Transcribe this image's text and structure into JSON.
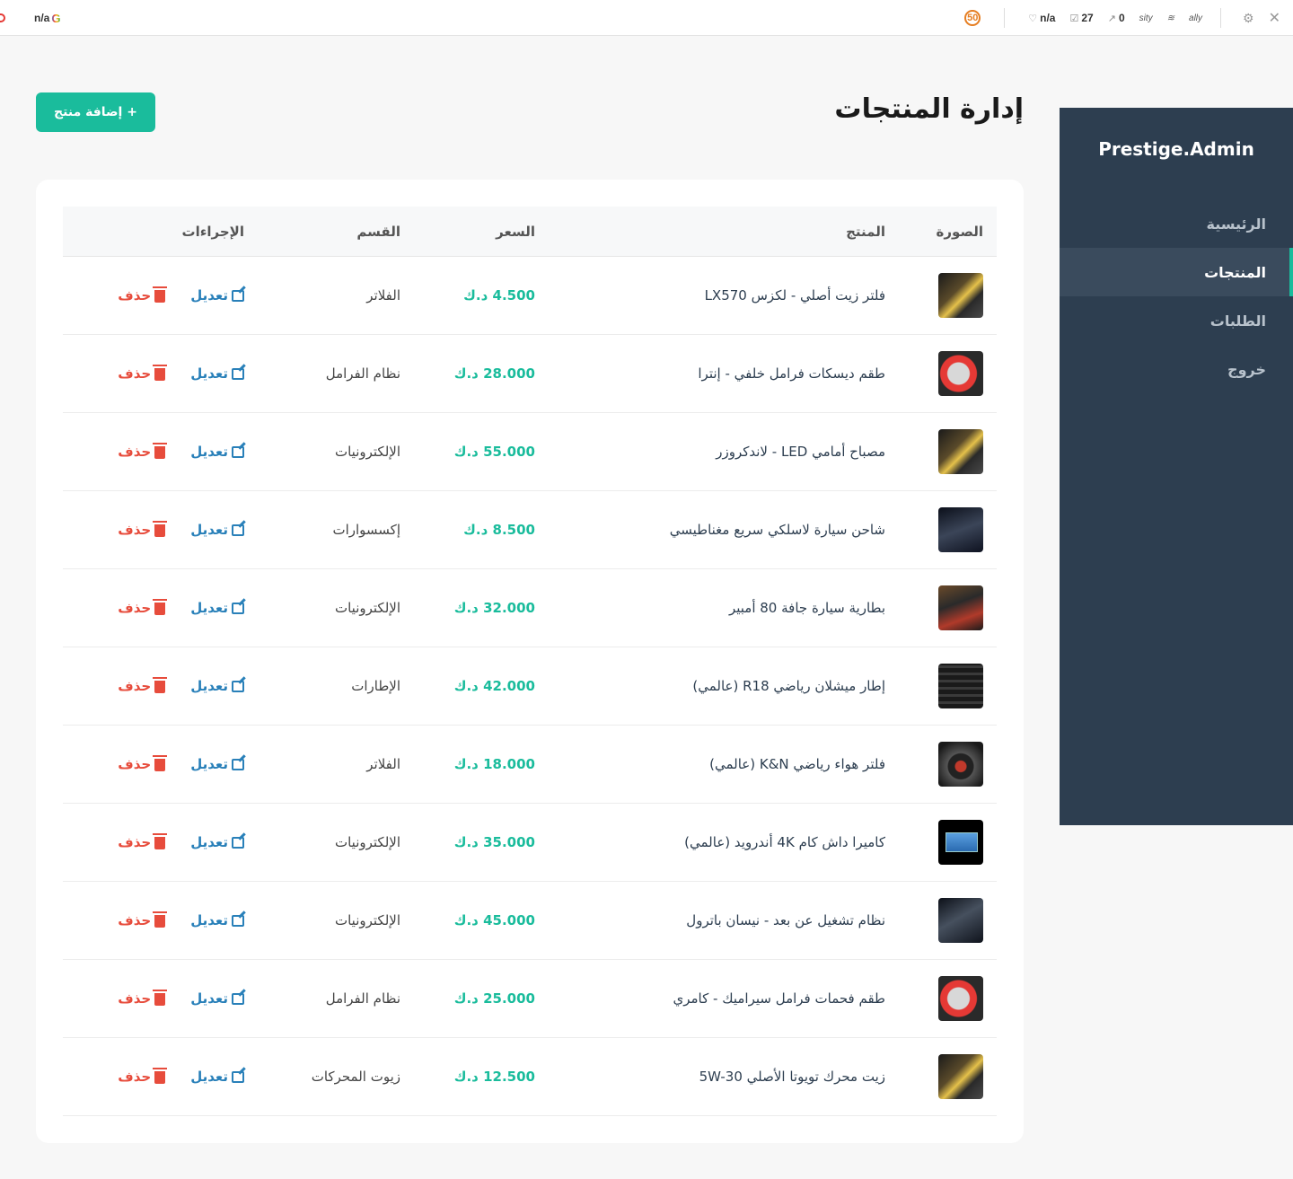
{
  "toolbar": {
    "left_text": "n/a",
    "google_icon": "G",
    "seo_badge": "50",
    "rank": "n/a",
    "pages": "27",
    "links": "0",
    "icon_a": "sity",
    "icon_b": "≋",
    "icon_c": "ally"
  },
  "sidebar": {
    "brand": "Prestige.Admin",
    "items": [
      {
        "label": "الرئيسية",
        "active": false
      },
      {
        "label": "المنتجات",
        "active": true
      },
      {
        "label": "الطلبات",
        "active": false
      },
      {
        "label": "خروج",
        "active": false
      }
    ]
  },
  "header": {
    "title": "إدارة المنتجات",
    "add_button": "+ إضافة منتج"
  },
  "table": {
    "columns": {
      "image": "الصورة",
      "product": "المنتج",
      "price": "السعر",
      "category": "القسم",
      "actions": "الإجراءات"
    },
    "edit_label": "تعديل",
    "delete_label": "حذف",
    "rows": [
      {
        "thumb": "oil",
        "name": "فلتر زيت أصلي - لكزس LX570",
        "price": "4.500 د.ك",
        "category": "الفلاتر"
      },
      {
        "thumb": "brake",
        "name": "طقم ديسكات فرامل خلفي - إنترا",
        "price": "28.000 د.ك",
        "category": "نظام الفرامل"
      },
      {
        "thumb": "oil",
        "name": "مصباح أمامي LED - لاندكروزر",
        "price": "55.000 د.ك",
        "category": "الإلكترونيات"
      },
      {
        "thumb": "charger",
        "name": "شاحن سيارة لاسلكي سريع مغناطيسي",
        "price": "8.500 د.ك",
        "category": "إكسسوارات"
      },
      {
        "thumb": "battery",
        "name": "بطارية سيارة جافة 80 أمبير",
        "price": "32.000 د.ك",
        "category": "الإلكترونيات"
      },
      {
        "thumb": "tire",
        "name": "إطار ميشلان رياضي R18 (عالمي)",
        "price": "42.000 د.ك",
        "category": "الإطارات"
      },
      {
        "thumb": "filter",
        "name": "فلتر هواء رياضي K&N (عالمي)",
        "price": "18.000 د.ك",
        "category": "الفلاتر"
      },
      {
        "thumb": "dash",
        "name": "كاميرا داش كام 4K أندرويد (عالمي)",
        "price": "35.000 د.ك",
        "category": "الإلكترونيات"
      },
      {
        "thumb": "remote",
        "name": "نظام تشغيل عن بعد - نيسان باترول",
        "price": "45.000 د.ك",
        "category": "الإلكترونيات"
      },
      {
        "thumb": "brake",
        "name": "طقم فحمات فرامل سيراميك - كامري",
        "price": "25.000 د.ك",
        "category": "نظام الفرامل"
      },
      {
        "thumb": "oil",
        "name": "زيت محرك تويوتا الأصلي 5W-30",
        "price": "12.500 د.ك",
        "category": "زيوت المحركات"
      }
    ]
  }
}
